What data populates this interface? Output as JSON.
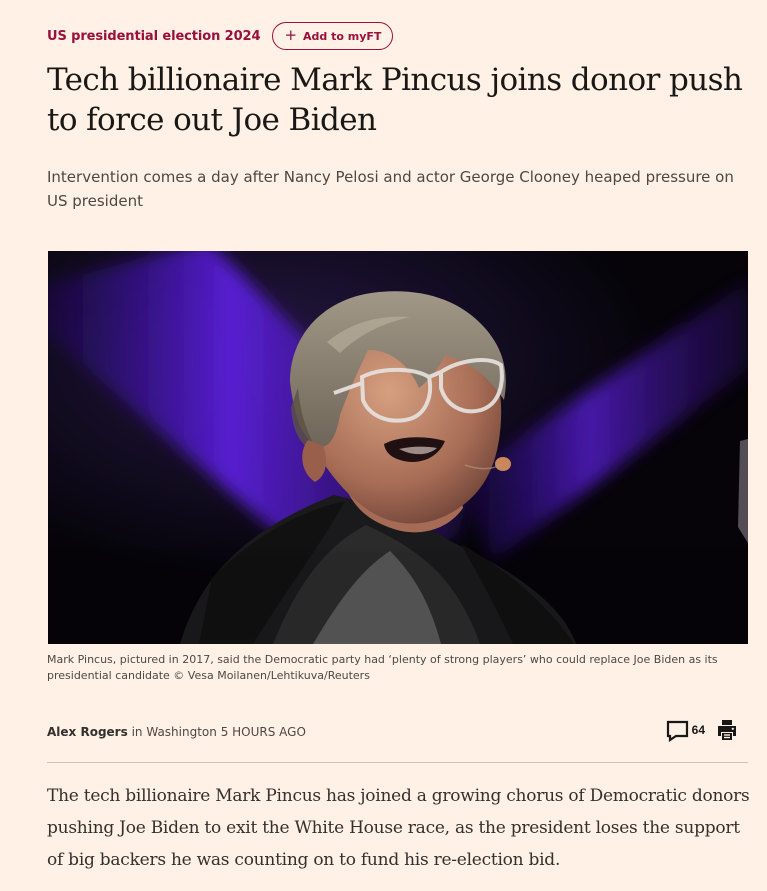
{
  "topic": {
    "label": "US presidential election 2024",
    "myft_button": {
      "icon": "plus-icon",
      "label": "Add to myFT"
    }
  },
  "article": {
    "headline": "Tech billionaire Mark Pincus joins donor push to force out Joe Biden",
    "standfirst": "Intervention comes a day after Nancy Pelosi and actor George Clooney heaped pressure on US president",
    "image": {
      "caption": "Mark Pincus, pictured in 2017, said the Democratic party had ‘plenty of strong players’ who could replace Joe Biden as its presidential candidate © Vesa Moilanen/Lehtikuva/Reuters"
    },
    "byline": {
      "author": "Alex Rogers",
      "location_prefix": "in",
      "location": "Washington",
      "timestamp": "5 HOURS AGO"
    },
    "tools": {
      "comment_icon": "speech-bubble-icon",
      "comment_count": "64",
      "print_icon": "printer-icon"
    },
    "body_first_paragraph": "The tech billionaire Mark Pincus has joined a growing chorus of Democratic donors pushing Joe Biden to exit the White House race, as the president loses the support of big backers he was counting on to fund his re-election bid."
  },
  "colors": {
    "background": "#fff1e5",
    "accent": "#990f3d",
    "text": "#33302e",
    "photo_purple": "#5a1fe0"
  }
}
